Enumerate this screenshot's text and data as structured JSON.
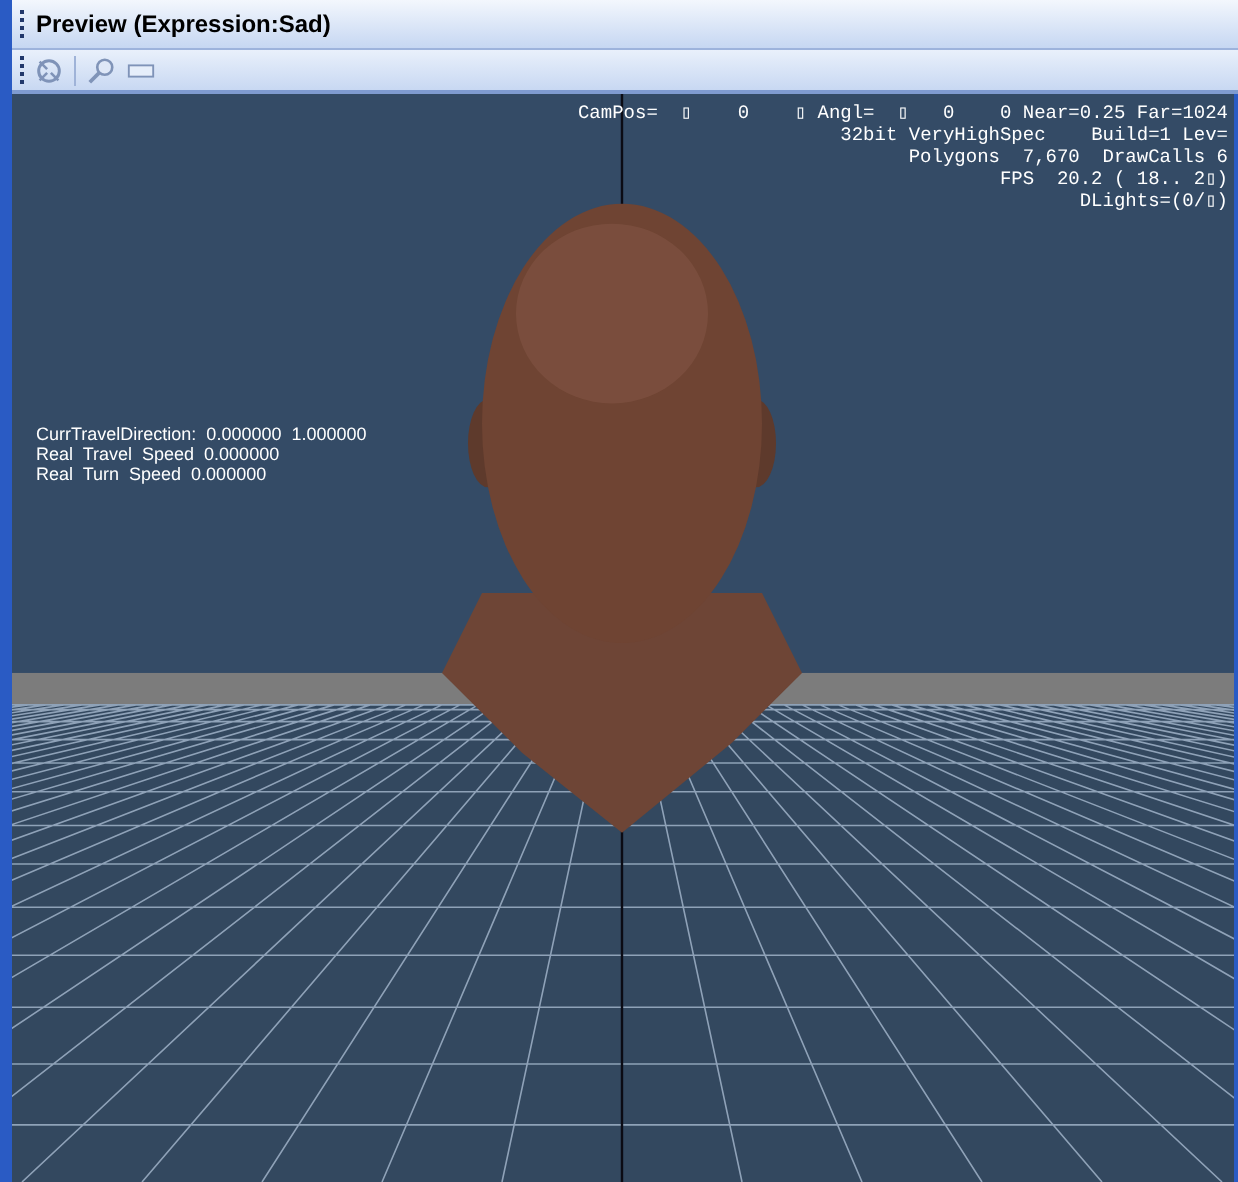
{
  "window": {
    "title": "Preview (Expression:Sad)"
  },
  "toolbar": [
    {
      "kind": "reset"
    },
    {
      "kind": "separator"
    },
    {
      "kind": "zoom"
    },
    {
      "kind": "frame"
    }
  ],
  "viewport": {
    "kind": "picture",
    "stats": [
      "CamPos=  ▯    0    ▯ Angl=  ▯   0    0 Near=0.25 Far=1024",
      "32bit VeryHighSpec    Build=1 Lev=",
      "Polygons  7,670  DrawCalls 6",
      "FPS  20.2 ( 18.. 2▯)",
      "DLights=(0/▯)"
    ],
    "travel": [
      "CurrTravelDirection:  0.000000  1.000000",
      "Real  Travel  Speed  0.000000",
      "Real  Turn  Speed  0.000000"
    ]
  }
}
